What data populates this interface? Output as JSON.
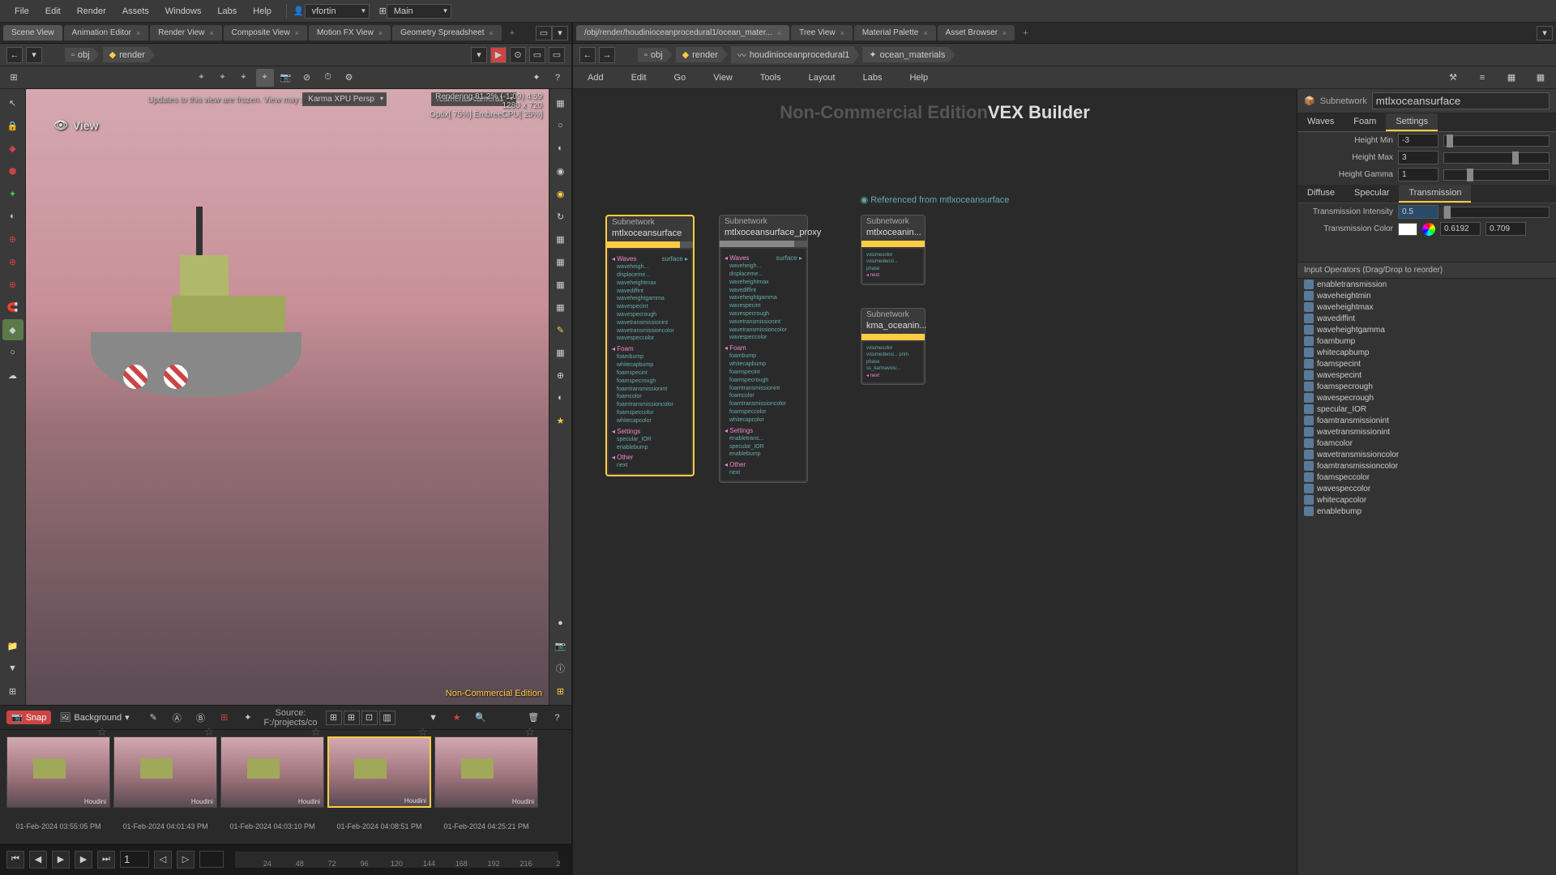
{
  "menubar": {
    "items": [
      "File",
      "Edit",
      "Render",
      "Assets",
      "Windows",
      "Labs",
      "Help"
    ],
    "user": "vfortin",
    "desktop": "Main"
  },
  "left_tabs": [
    "Scene View",
    "Animation Editor",
    "Render View",
    "Composite View",
    "Motion FX View",
    "Geometry Spreadsheet"
  ],
  "right_tabs": [
    "/obj/render/houdinioceanprocedural1/ocean_mater...",
    "Tree View",
    "Material Palette",
    "Asset Browser"
  ],
  "breadcrumb_left": [
    "obj",
    "render"
  ],
  "breadcrumb_right": [
    "obj",
    "render",
    "houdinioceanprocedural1",
    "ocean_materials"
  ],
  "viewport": {
    "label": "View",
    "status": "Updates to this view are frozen. View may be out of date.",
    "renderer_dropdown": "Karma XPU  Persp",
    "camera_dropdown": "/cameras/camera1",
    "render_stats": "Rendering  81.2%  (-1:09)  4:59",
    "render_res": "1280 x 720",
    "render_engine": "Optix[ 75%] EmbreeCPU[ 25%]",
    "watermark": "Non-Commercial Edition"
  },
  "snapshot_bar": {
    "snap": "Snap",
    "background": "Background",
    "source": "Source:   F:/projects/co"
  },
  "snapshots": [
    {
      "time": "01-Feb-2024 03:55:05 PM",
      "wm": "Houdini"
    },
    {
      "time": "01-Feb-2024 04:01:43 PM",
      "wm": "Houdini"
    },
    {
      "time": "01-Feb-2024 04:03:10 PM",
      "wm": "Houdini"
    },
    {
      "time": "01-Feb-2024 04:08:51 PM",
      "wm": "Houdini",
      "selected": true
    },
    {
      "time": "01-Feb-2024 04:25:21 PM",
      "wm": "Houdini"
    }
  ],
  "timeline": {
    "frame": "1",
    "ticks": [
      "24",
      "48",
      "72",
      "96",
      "120",
      "144",
      "168",
      "192",
      "216",
      "2"
    ]
  },
  "network_menu": [
    "Add",
    "Edit",
    "Go",
    "View",
    "Tools",
    "Layout",
    "Labs",
    "Help"
  ],
  "network_watermark": "Non-Commercial Edition",
  "network_builder": "VEX Builder",
  "network_ref": "Referenced from mtlxoceansurface",
  "nodes": {
    "n1": {
      "type": "Subnetwork",
      "name": "mtlxoceansurface"
    },
    "n2": {
      "type": "Subnetwork",
      "name": "mtlxoceansurface_proxy"
    },
    "n3": {
      "type": "Subnetwork",
      "name": "mtlxoceanin..."
    },
    "n4": {
      "type": "Subnetwork",
      "name": "kma_oceanin..."
    }
  },
  "node_sections": {
    "waves": "Waves",
    "foam": "Foam",
    "settings": "Settings",
    "other": "Other",
    "surface": "surface",
    "next": "next"
  },
  "node_params_waves": [
    "waveheigh...",
    "displaceme...",
    "waveheightmax",
    "wavediffint",
    "waveheightgamma",
    "wavespecint",
    "wavespecrough",
    "wavetransmissionint",
    "wavetransmissioncolor",
    "wavespeccolor"
  ],
  "node_params_foam": [
    "foambump",
    "whitecapbump",
    "foamspecint",
    "foamspecrough",
    "foamtransmissionint",
    "foamcolor",
    "foamtransmissioncolor",
    "foamspeccolor",
    "whitecapcolor"
  ],
  "node_params_settings": [
    "specular_IOR",
    "enablebump"
  ],
  "node_params_settings2": [
    "enabletrans...",
    "specular_IOR",
    "enablebump"
  ],
  "param_panel": {
    "type": "Subnetwork",
    "name": "mtlxoceansurface",
    "tabs": [
      "Waves",
      "Foam",
      "Settings"
    ],
    "subtabs": [
      "Diffuse",
      "Specular",
      "Transmission"
    ],
    "height_min_label": "Height Min",
    "height_min": "-3",
    "height_max_label": "Height Max",
    "height_max": "3",
    "height_gamma_label": "Height Gamma",
    "height_gamma": "1",
    "trans_intensity_label": "Transmission Intensity",
    "trans_intensity": "0.5",
    "trans_color_label": "Transmission Color",
    "trans_color_r": "0.6192",
    "trans_color_g": "0.709"
  },
  "io_header": "Input Operators (Drag/Drop to reorder)",
  "io_list": [
    "enabletransmission",
    "waveheightmin",
    "waveheightmax",
    "wavediffint",
    "waveheightgamma",
    "foambump",
    "whitecapbump",
    "foamspecint",
    "wavespecint",
    "foamspecrough",
    "wavespecrough",
    "specular_IOR",
    "foamtransmissionint",
    "wavetransmissionint",
    "foamcolor",
    "wavetransmissioncolor",
    "foamtransmissioncolor",
    "foamspeccolor",
    "wavespeccolor",
    "whitecapcolor",
    "enablebump"
  ]
}
